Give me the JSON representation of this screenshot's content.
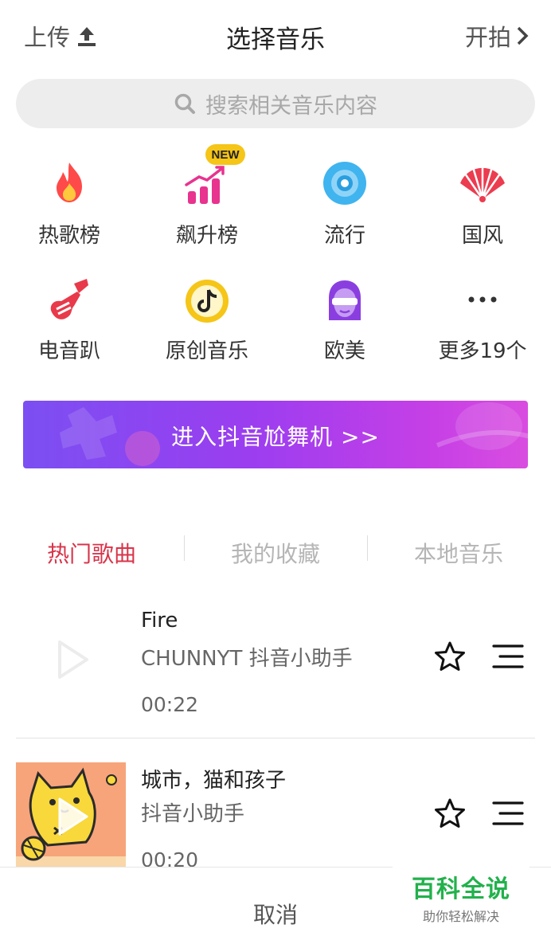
{
  "header": {
    "upload_label": "上传",
    "title": "选择音乐",
    "start_label": "开拍"
  },
  "search": {
    "placeholder": "搜索相关音乐内容"
  },
  "categories": [
    {
      "label": "热歌榜",
      "icon": "hot-chart-icon"
    },
    {
      "label": "飙升榜",
      "icon": "rising-chart-icon",
      "badge": "NEW"
    },
    {
      "label": "流行",
      "icon": "pop-disc-icon"
    },
    {
      "label": "国风",
      "icon": "chinese-fan-icon"
    },
    {
      "label": "电音趴",
      "icon": "electric-guitar-icon"
    },
    {
      "label": "原创音乐",
      "icon": "tiktok-note-icon"
    },
    {
      "label": "欧美",
      "icon": "western-avatar-icon"
    },
    {
      "label": "更多19个",
      "icon": "more-dots-icon"
    }
  ],
  "banner": {
    "label": "进入抖音尬舞机 >>"
  },
  "tabs": [
    {
      "label": "热门歌曲",
      "active": true
    },
    {
      "label": "我的收藏",
      "active": false
    },
    {
      "label": "本地音乐",
      "active": false
    }
  ],
  "songs": [
    {
      "title": "Fire",
      "artist": "CHUNNYT 抖音小助手",
      "duration": "00:22"
    },
    {
      "title": "城市，猫和孩子",
      "artist": "抖音小助手",
      "duration": "00:20"
    }
  ],
  "footer": {
    "cancel_label": "取消"
  },
  "watermark": {
    "title": "百科全说",
    "subtitle": "助你轻松解决"
  },
  "colors": {
    "accent": "#d8344a",
    "tab_inactive": "#b5b5b5",
    "watermark": "#22b14c"
  }
}
